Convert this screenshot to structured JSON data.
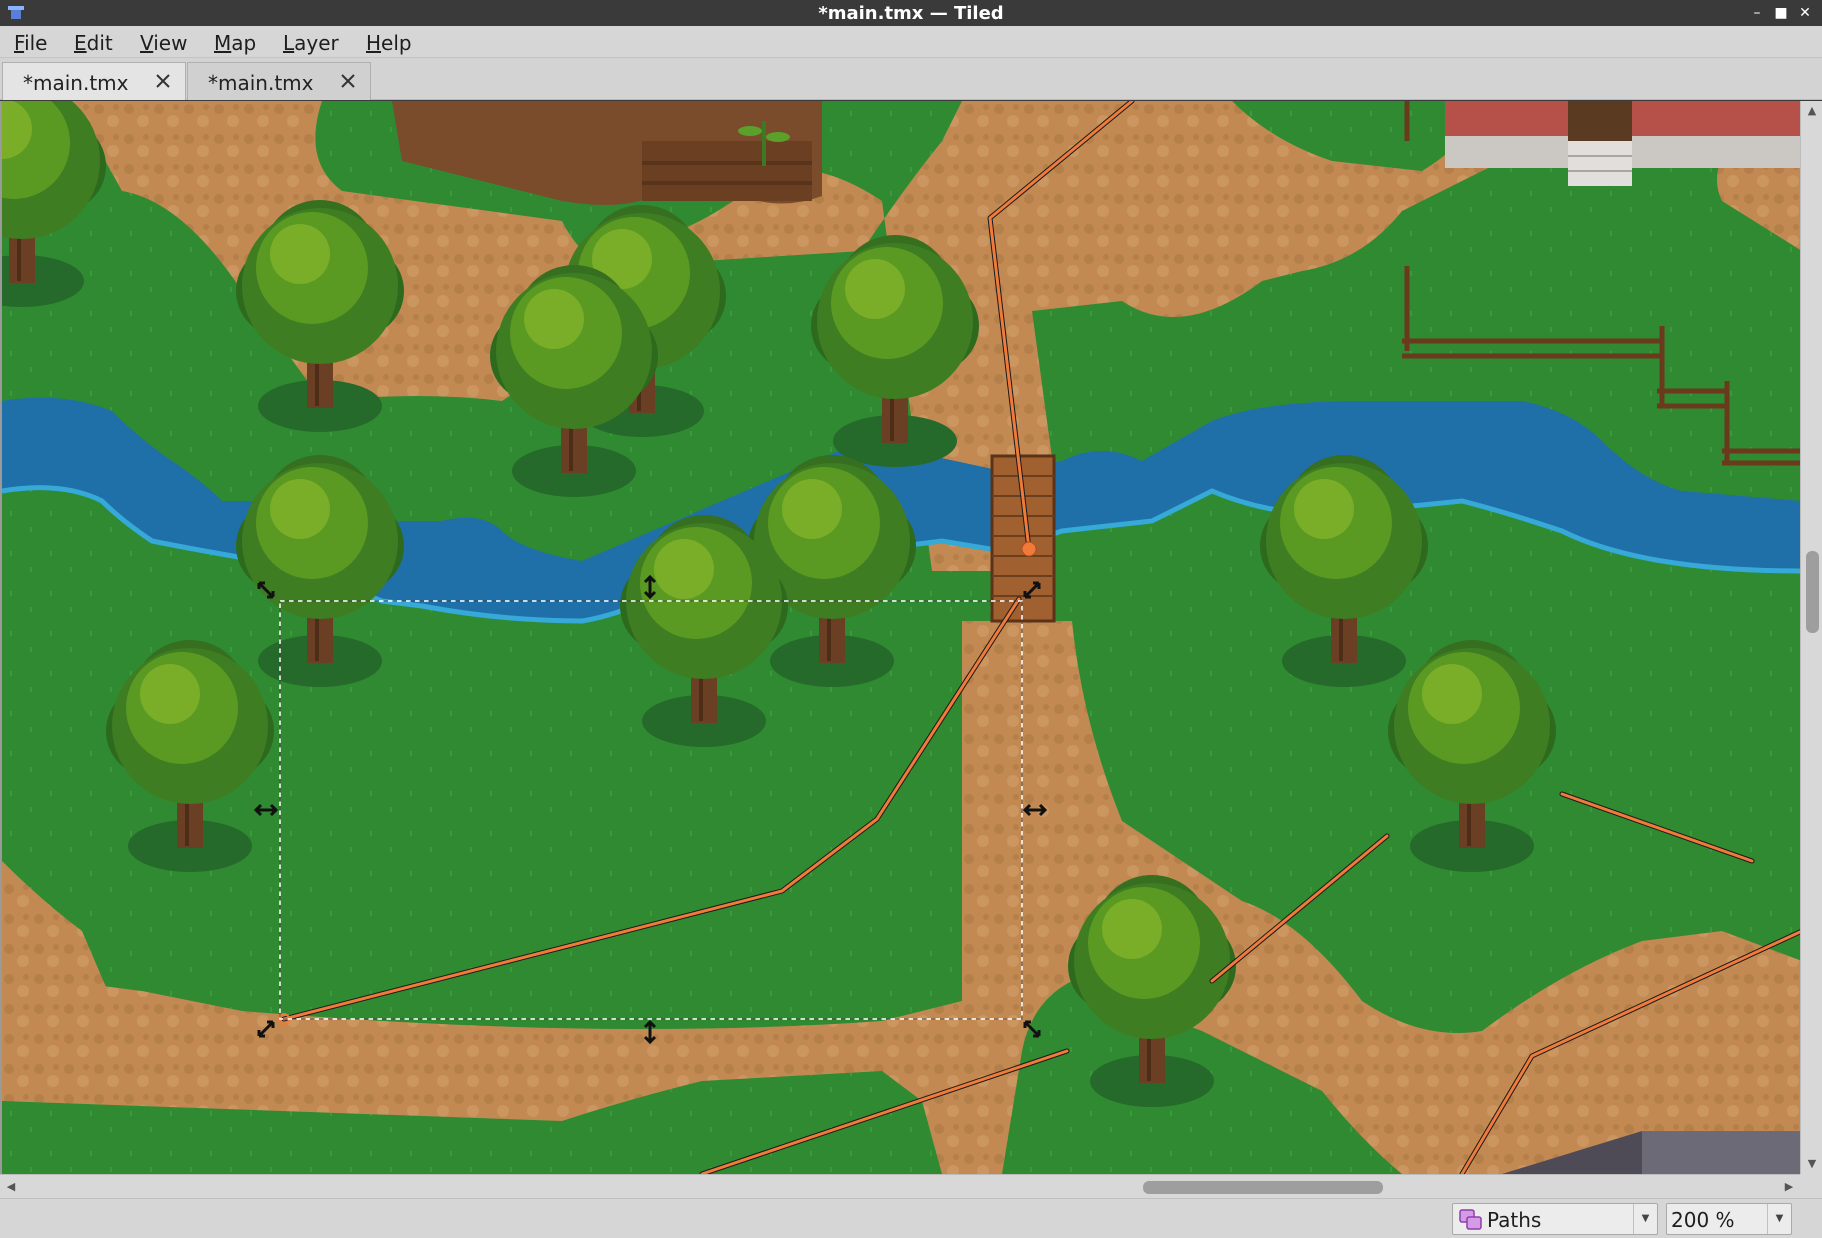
{
  "window": {
    "title": "*main.tmx — Tiled",
    "icons": [
      "app-icon",
      "minimize-icon",
      "maximize-icon",
      "close-icon"
    ]
  },
  "menu": {
    "items": [
      "File",
      "Edit",
      "View",
      "Map",
      "Layer",
      "Help"
    ]
  },
  "tabs": [
    {
      "label": "*main.tmx",
      "active": true
    },
    {
      "label": "*main.tmx",
      "active": false
    }
  ],
  "map": {
    "layer_objects": "paths",
    "colors": {
      "grass": "#2f8a32",
      "grass_light": "#3e9c3a",
      "dirt": "#c28a52",
      "water": "#1f6fa8",
      "tree_canopy": "#5b9a22",
      "tree_trunk": "#6b3f24",
      "path_line": "#f07a3a",
      "selection": "#ffffff"
    }
  },
  "status": {
    "layer_combo": "Paths",
    "zoom_combo": "200 %"
  }
}
